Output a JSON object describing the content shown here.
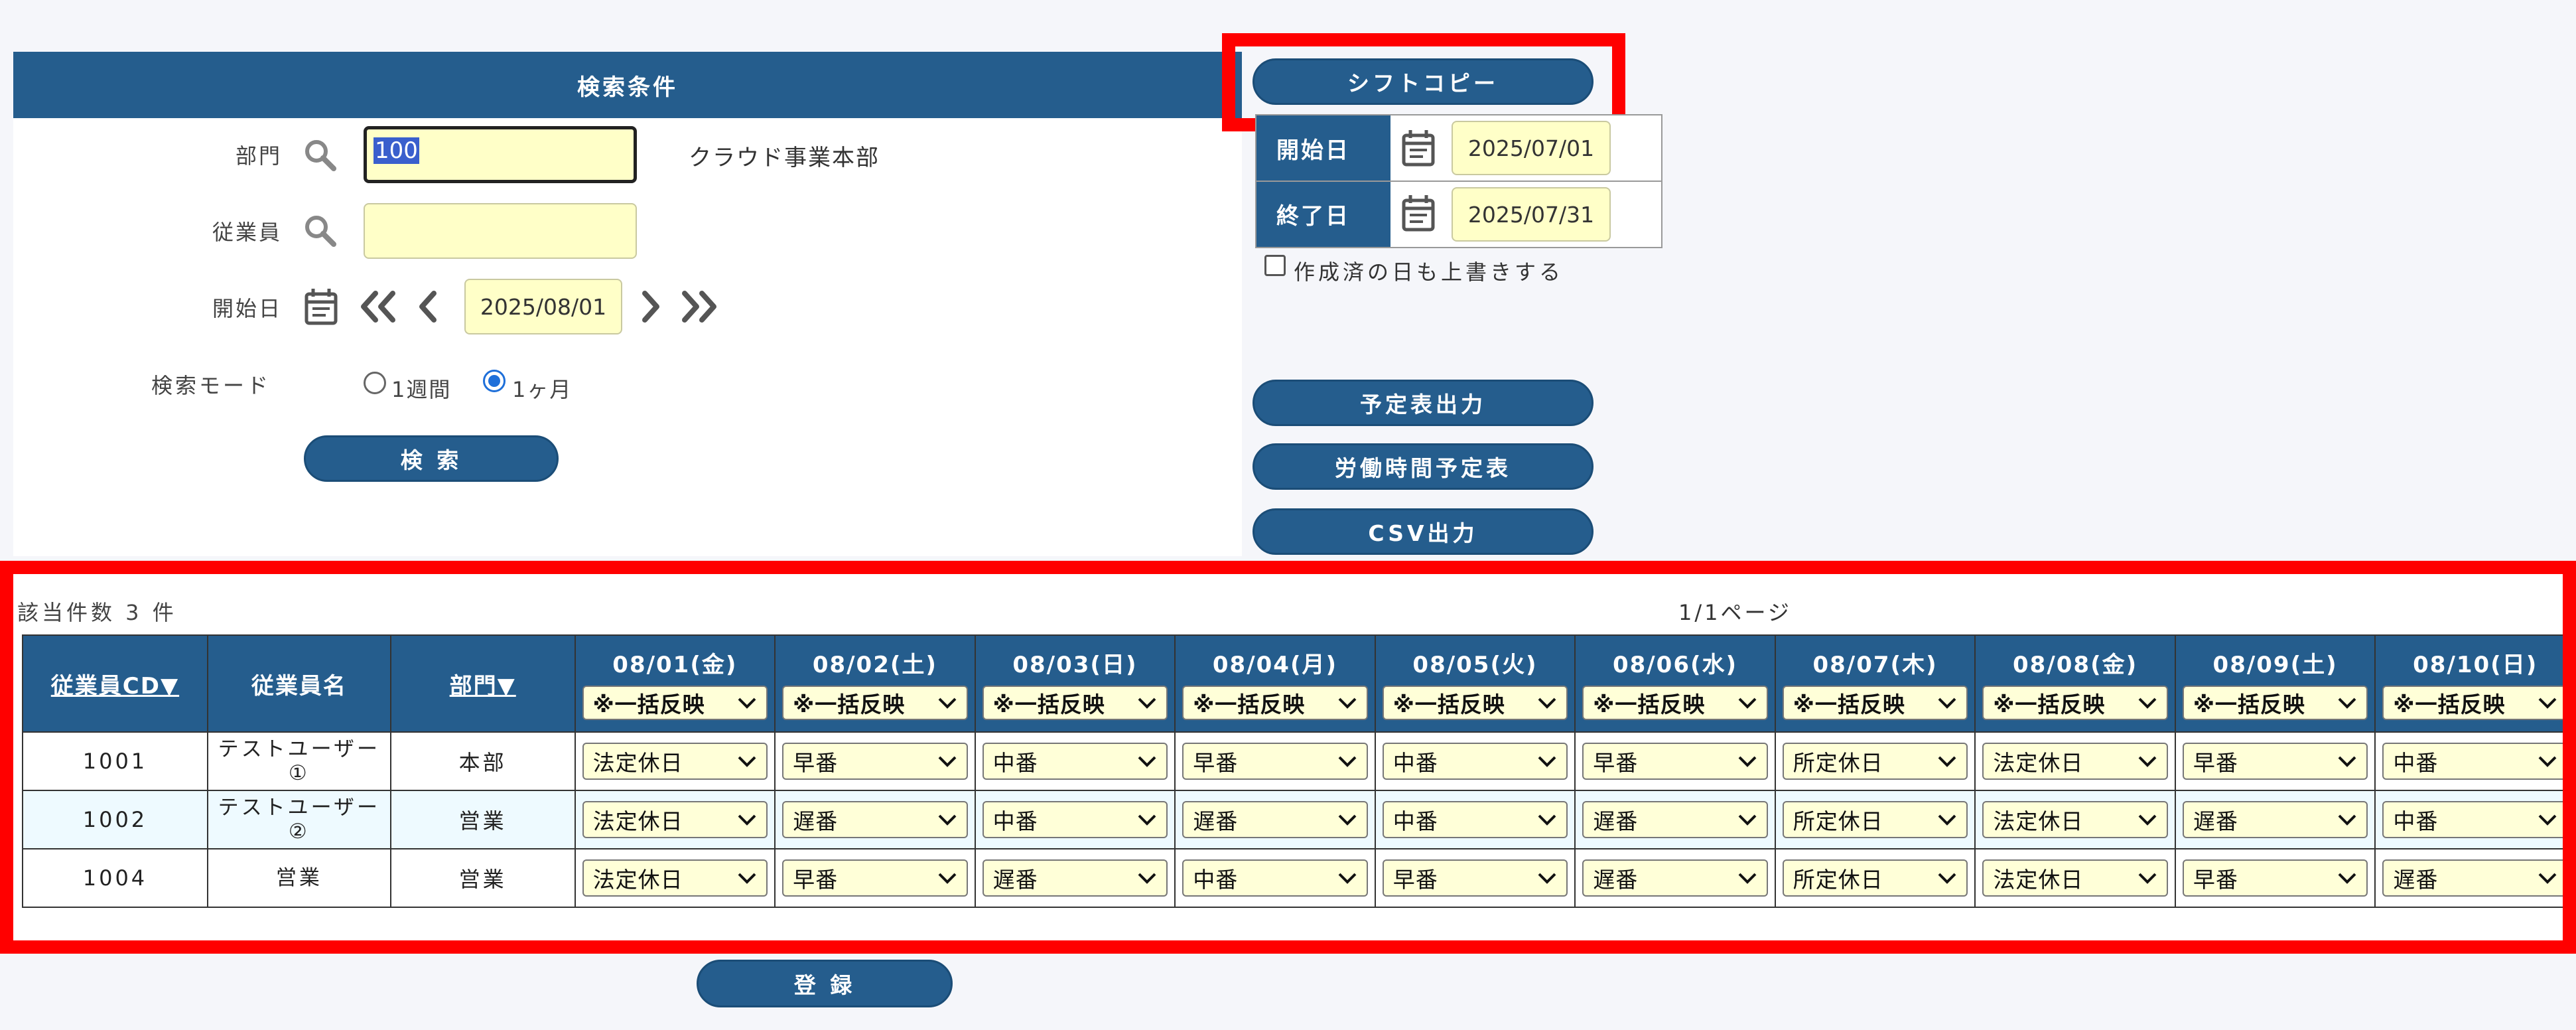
{
  "search": {
    "header": "検索条件",
    "dept_label": "部門",
    "dept_value": "100",
    "dept_name": "クラウド事業本部",
    "employee_label": "従業員",
    "employee_value": "",
    "start_label": "開始日",
    "start_value": "2025/08/01",
    "mode_label": "検索モード",
    "mode_options": [
      "1週間",
      "1ヶ月"
    ],
    "mode_selected": "1ヶ月",
    "search_button": "検 索"
  },
  "shift_copy": {
    "button": "シフトコピー",
    "start_label": "開始日",
    "start_value": "2025/07/01",
    "end_label": "終了日",
    "end_value": "2025/07/31",
    "overwrite_label": "作成済の日も上書きする",
    "overwrite_checked": false
  },
  "actions": {
    "schedule_output": "予定表出力",
    "work_hours_schedule": "労働時間予定表",
    "csv_output": "CSV出力",
    "register": "登 録"
  },
  "results": {
    "count_text": "該当件数 3 件",
    "page_text": "1/1ページ",
    "columns": {
      "emp_cd": "従業員CD▼",
      "emp_name": "従業員名",
      "dept": "部門▼"
    },
    "bulk_label": "※一括反映",
    "dates": [
      "08/01(金)",
      "08/02(土)",
      "08/03(日)",
      "08/04(月)",
      "08/05(火)",
      "08/06(水)",
      "08/07(木)",
      "08/08(金)",
      "08/09(土)",
      "08/10(日)"
    ],
    "rows": [
      {
        "cd": "1001",
        "name": "テストユーザー①",
        "dept": "本部",
        "shifts": [
          "法定休日",
          "早番",
          "中番",
          "早番",
          "中番",
          "早番",
          "所定休日",
          "法定休日",
          "早番",
          "中番"
        ]
      },
      {
        "cd": "1002",
        "name": "テストユーザー②",
        "dept": "営業",
        "shifts": [
          "法定休日",
          "遅番",
          "中番",
          "遅番",
          "中番",
          "遅番",
          "所定休日",
          "法定休日",
          "遅番",
          "中番"
        ]
      },
      {
        "cd": "1004",
        "name": "営業",
        "dept": "営業",
        "shifts": [
          "法定休日",
          "早番",
          "遅番",
          "中番",
          "早番",
          "遅番",
          "所定休日",
          "法定休日",
          "早番",
          "遅番"
        ]
      }
    ]
  },
  "colors": {
    "header_blue": "#255d8d",
    "input_yellow": "#ffffc8",
    "highlight_red": "#ff0000"
  }
}
